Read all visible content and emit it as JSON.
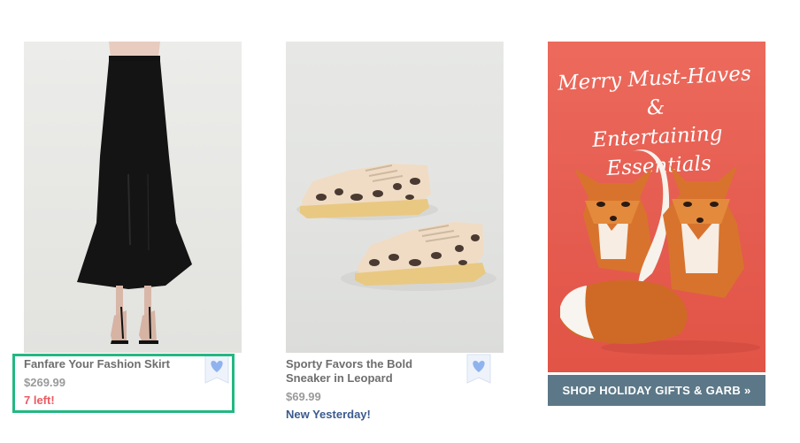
{
  "products": [
    {
      "name": "Fanfare Your Fashion Skirt",
      "price": "$269.99",
      "badge": "7 left!"
    },
    {
      "name": "Sporty Favors the Bold Sneaker in Leopard",
      "price": "$69.99",
      "badge": "New Yesterday!"
    }
  ],
  "promo": {
    "headline_line1": "Merry Must-Haves &",
    "headline_line2": "Entertaining Essentials",
    "cta": "SHOP HOLIDAY GIFTS & GARB »"
  },
  "colors": {
    "highlight_border": "#22b882",
    "stock_red": "#ec5b63",
    "new_blue": "#3b5a8e",
    "favorite_heart": "#8fb3ee",
    "promo_bg": "#e55c50",
    "cta_bg": "#5c7888"
  }
}
